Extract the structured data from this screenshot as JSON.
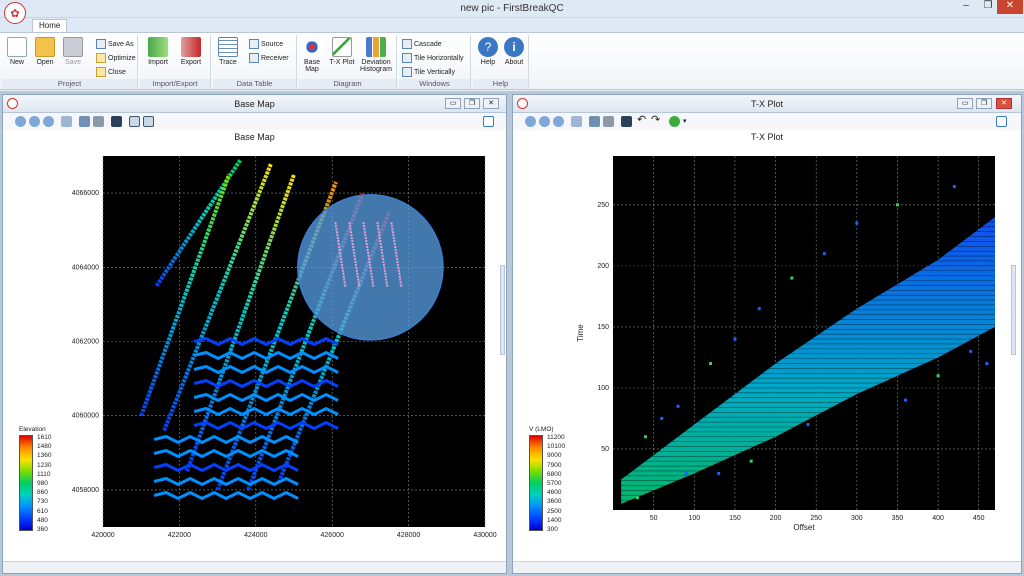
{
  "window": {
    "title": "new pic - FirstBreakQC",
    "min": "‒",
    "max": "❐",
    "close": "✕"
  },
  "ribbon": {
    "tab": "Home",
    "groups": [
      {
        "label": "Project"
      },
      {
        "label": "Import/Export"
      },
      {
        "label": "Data Table"
      },
      {
        "label": "Diagram"
      },
      {
        "label": "Windows"
      },
      {
        "label": "Help"
      }
    ],
    "buttons": {
      "new": "New",
      "open": "Open",
      "save": "Save",
      "save_as": "Save As",
      "optimize": "Optimize",
      "close": "Close",
      "import": "Import",
      "export": "Export",
      "trace": "Trace",
      "source": "Source",
      "receiver": "Receiver",
      "base_map": "Base Map",
      "tx_plot": "T-X Plot",
      "deviation_histogram": "Deviation Histogram",
      "cascade": "Cascade",
      "tile_horizontally": "Tile Horizontally",
      "tile_vertically": "Tile Vertically",
      "help": "Help",
      "about": "About"
    }
  },
  "left_panel": {
    "title": "Base Map",
    "chart_title": "Base Map",
    "legend": {
      "title": "Elevation",
      "values": [
        "1610",
        "1480",
        "1360",
        "1230",
        "1110",
        "980",
        "860",
        "730",
        "610",
        "480",
        "360"
      ]
    }
  },
  "right_panel": {
    "title": "T-X Plot",
    "chart_title": "T-X Plot",
    "legend": {
      "title": "V (LMO)",
      "values": [
        "11200",
        "10100",
        "9000",
        "7900",
        "6800",
        "5700",
        "4600",
        "3600",
        "2500",
        "1400",
        "300"
      ]
    }
  },
  "chart_data": [
    {
      "type": "scatter",
      "title": "Base Map",
      "xlabel": "",
      "ylabel": "",
      "xlim": [
        420000,
        430000
      ],
      "ylim": [
        4057000,
        4067000
      ],
      "x_ticks": [
        "420000",
        "422000",
        "424000",
        "426000",
        "428000",
        "430000"
      ],
      "y_ticks": [
        "4058000",
        "4060000",
        "4062000",
        "4064000",
        "4066000"
      ],
      "grid": true,
      "legend_title": "Elevation",
      "colorbar": [
        "1610",
        "1480",
        "1360",
        "1230",
        "1110",
        "980",
        "860",
        "730",
        "610",
        "480",
        "360"
      ],
      "series": [
        {
          "values": [
            [
              421400,
              4063500
            ],
            [
              423600,
              4066900
            ]
          ]
        },
        {
          "values": [
            [
              421000,
              4060000
            ],
            [
              423300,
              4066500
            ]
          ]
        },
        {
          "values": [
            [
              421600,
              4059600
            ],
            [
              424400,
              4066800
            ]
          ]
        },
        {
          "values": [
            [
              422200,
              4058500
            ],
            [
              425000,
              4066500
            ]
          ]
        },
        {
          "values": [
            [
              423000,
              4058000
            ],
            [
              426100,
              4066300
            ]
          ]
        },
        {
          "values": [
            [
              423800,
              4058000
            ],
            [
              426800,
              4066000
            ]
          ]
        },
        {
          "values": [
            [
              424600,
              4058200
            ],
            [
              427500,
              4065500
            ]
          ]
        }
      ],
      "highlight_circle": {
        "center": [
          427000,
          4064000
        ],
        "radius": 1900
      }
    },
    {
      "type": "scatter",
      "title": "T-X Plot",
      "xlabel": "Offset",
      "ylabel": "Time",
      "xlim": [
        0,
        470
      ],
      "ylim": [
        0,
        290
      ],
      "x_ticks": [
        "50",
        "100",
        "150",
        "200",
        "250",
        "300",
        "350",
        "400",
        "450"
      ],
      "y_ticks": [
        "50",
        "100",
        "150",
        "200",
        "250"
      ],
      "grid": true,
      "legend_title": "V (LMO)",
      "colorbar": [
        "11200",
        "10100",
        "9000",
        "7900",
        "6800",
        "5700",
        "4600",
        "3600",
        "2500",
        "1400",
        "300"
      ],
      "band": {
        "lower": [
          [
            10,
            5
          ],
          [
            100,
            30
          ],
          [
            200,
            60
          ],
          [
            300,
            95
          ],
          [
            400,
            125
          ],
          [
            470,
            150
          ]
        ],
        "upper": [
          [
            10,
            25
          ],
          [
            100,
            70
          ],
          [
            200,
            120
          ],
          [
            300,
            165
          ],
          [
            400,
            205
          ],
          [
            470,
            240
          ]
        ]
      }
    }
  ]
}
